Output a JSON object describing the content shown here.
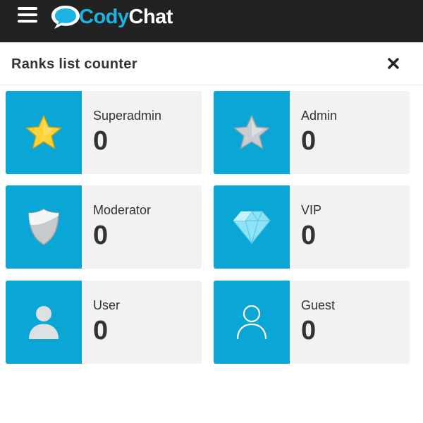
{
  "header": {
    "logo": {
      "text_a": "Cody",
      "text_b": "Chat"
    }
  },
  "panel": {
    "title": "Ranks list counter"
  },
  "ranks": [
    {
      "label": "Superadmin",
      "count": "0",
      "icon": "gold-star-icon"
    },
    {
      "label": "Admin",
      "count": "0",
      "icon": "silver-star-icon"
    },
    {
      "label": "Moderator",
      "count": "0",
      "icon": "shield-icon"
    },
    {
      "label": "VIP",
      "count": "0",
      "icon": "diamond-icon"
    },
    {
      "label": "User",
      "count": "0",
      "icon": "user-icon"
    },
    {
      "label": "Guest",
      "count": "0",
      "icon": "user-outline-icon"
    }
  ],
  "colors": {
    "topbar": "#222222",
    "accent": "#0aa6d6",
    "card_bg": "#f2f2f2"
  }
}
